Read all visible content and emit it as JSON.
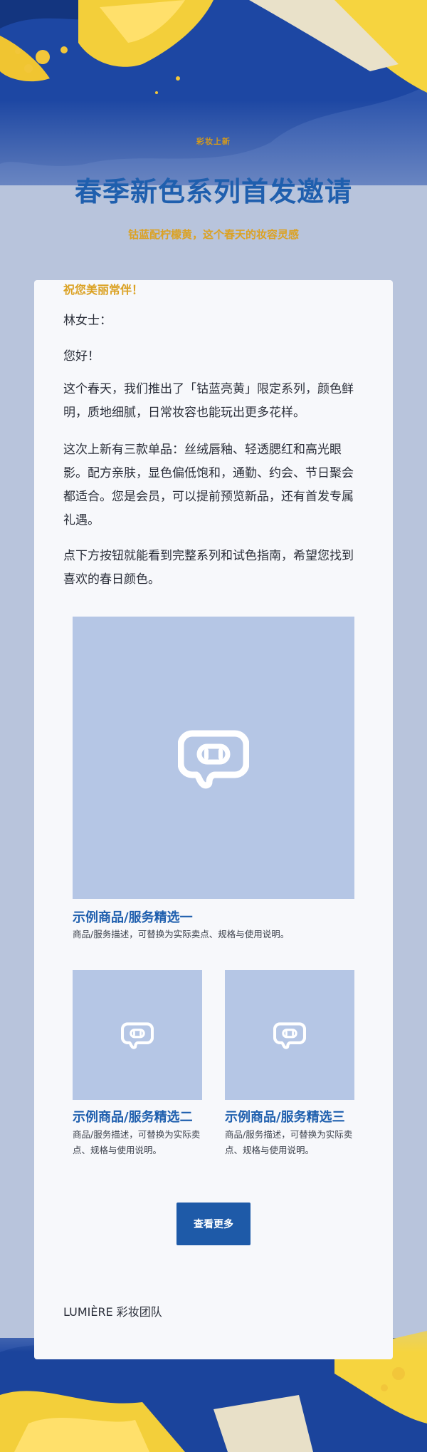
{
  "header": {
    "tagline": "彩妆上新",
    "title": "春季新色系列首发邀请",
    "subtitle": "钴蓝配柠檬黄，这个春天的妆容灵感"
  },
  "letter": {
    "salutation": "林女士：",
    "hello": "您好！",
    "para1": "这个春天，我们推出了「钴蓝亮黄」限定系列，颜色鲜明，质地细腻，日常妆容也能玩出更多花样。",
    "para2": "这次上新有三款单品：丝绒唇釉、轻透腮红和高光眼影。配方亲肤，显色偏低饱和，通勤、约会、节日聚会都适合。您是会员，可以提前预览新品，还有首发专属礼遇。",
    "para3": "点下方按钮就能看到完整系列和试色指南，希望您找到喜欢的春日颜色。"
  },
  "products": [
    {
      "title": "示例商品/服务精选一",
      "desc": "商品/服务描述，可替换为实际卖点、规格与使用说明。",
      "icon": "image-placeholder-icon"
    },
    {
      "title": "示例商品/服务精选二",
      "desc": "商品/服务描述，可替换为实际卖点、规格与使用说明。",
      "icon": "image-placeholder-icon"
    },
    {
      "title": "示例商品/服务精选三",
      "desc": "商品/服务描述，可替换为实际卖点、规格与使用说明。",
      "icon": "image-placeholder-icon"
    }
  ],
  "cta": {
    "label": "查看更多"
  },
  "closing": {
    "wish": "祝您美丽常伴！",
    "signature": "LUMIÈRE 彩妆团队"
  },
  "colors": {
    "accent_blue": "#1e5aa8",
    "accent_yellow": "#dba224",
    "placeholder": "#b5c6e5",
    "background": "#b8c4dc"
  }
}
